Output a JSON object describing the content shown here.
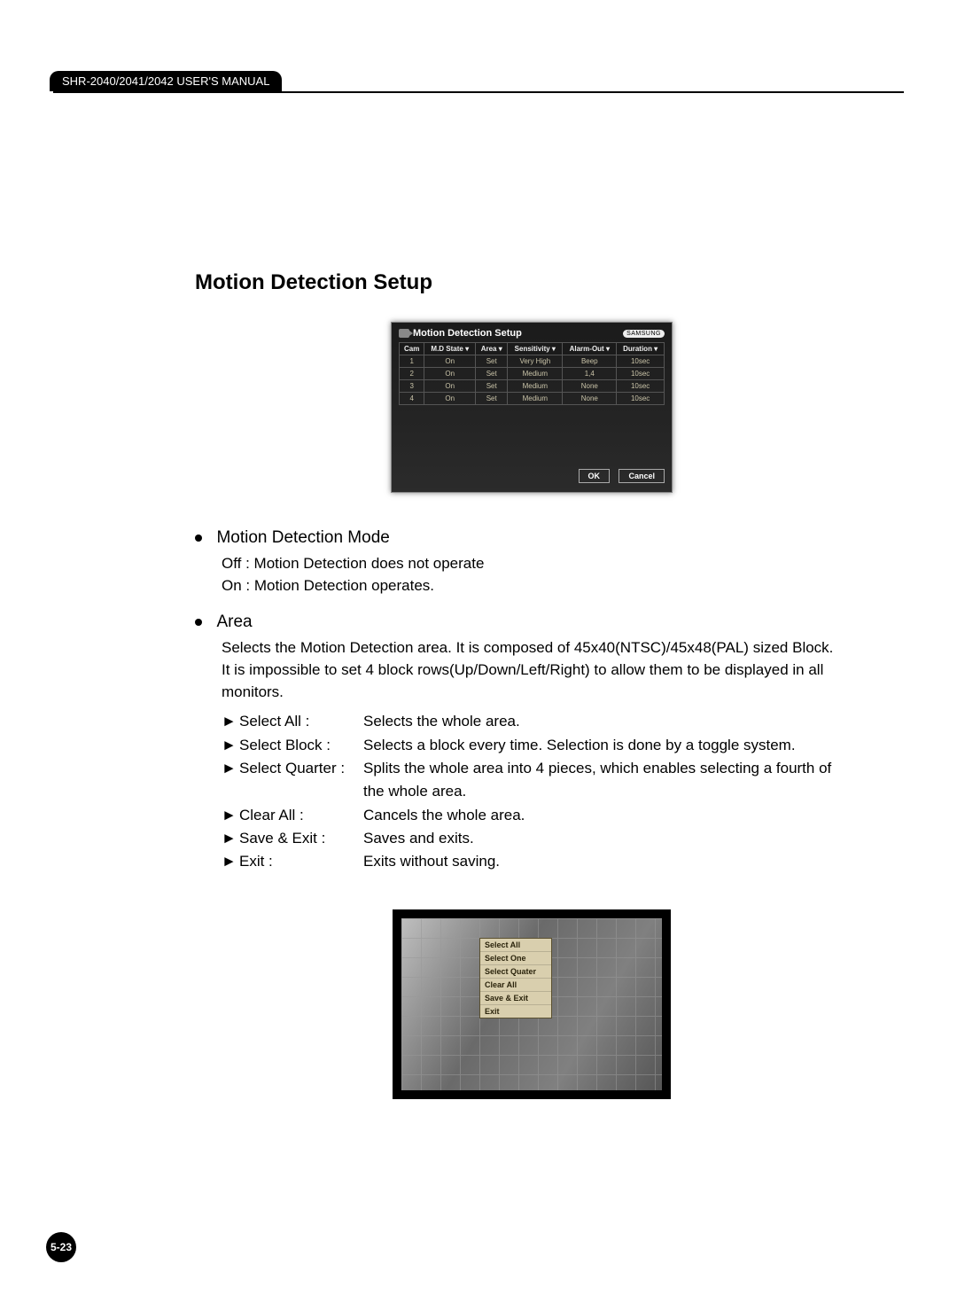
{
  "header": {
    "manual_title": "SHR-2040/2041/2042 USER'S MANUAL"
  },
  "section_title": "Motion Detection Setup",
  "setup_screenshot": {
    "title": "Motion Detection Setup",
    "logo": "SAMSUNG",
    "headers": [
      "Cam",
      "M.D State ▾",
      "Area ▾",
      "Sensitivity ▾",
      "Alarm-Out ▾",
      "Duration ▾"
    ],
    "rows": [
      [
        "1",
        "On",
        "Set",
        "Very High",
        "Beep",
        "10sec"
      ],
      [
        "2",
        "On",
        "Set",
        "Medium",
        "1,4",
        "10sec"
      ],
      [
        "3",
        "On",
        "Set",
        "Medium",
        "None",
        "10sec"
      ],
      [
        "4",
        "On",
        "Set",
        "Medium",
        "None",
        "10sec"
      ]
    ],
    "ok": "OK",
    "cancel": "Cancel"
  },
  "mode": {
    "title": "Motion Detection Mode",
    "off_text": "Off : Motion Detection does not operate",
    "on_text": "On : Motion Detection operates."
  },
  "area": {
    "title": "Area",
    "desc1": "Selects the Motion Detection area. It is composed of 45x40(NTSC)/45x48(PAL) sized Block.",
    "desc2": "It is impossible to set 4 block rows(Up/Down/Left/Right) to allow them to be displayed in all monitors.",
    "items": [
      {
        "arrow": "►",
        "label": "Select All :",
        "desc": "Selects the whole area."
      },
      {
        "arrow": "►",
        "label": "Select Block :",
        "desc": "Selects a block every time. Selection is done by a toggle system."
      },
      {
        "arrow": "►",
        "label": "Select Quarter :",
        "desc": "Splits the whole area into 4 pieces, which enables selecting a fourth of"
      },
      {
        "arrow": "",
        "label": "",
        "desc_cont": "the whole area."
      },
      {
        "arrow": "►",
        "label": "Clear All :",
        "desc": "Cancels the whole area."
      },
      {
        "arrow": "►",
        "label": "Save & Exit :",
        "desc": "Saves and exits."
      },
      {
        "arrow": "►",
        "label": "Exit :",
        "desc": "Exits without saving."
      }
    ]
  },
  "area_menu": {
    "items": [
      "Select All",
      "Select One",
      "Select Quater",
      "Clear All",
      "Save & Exit",
      "Exit"
    ]
  },
  "page_number": "5-23"
}
